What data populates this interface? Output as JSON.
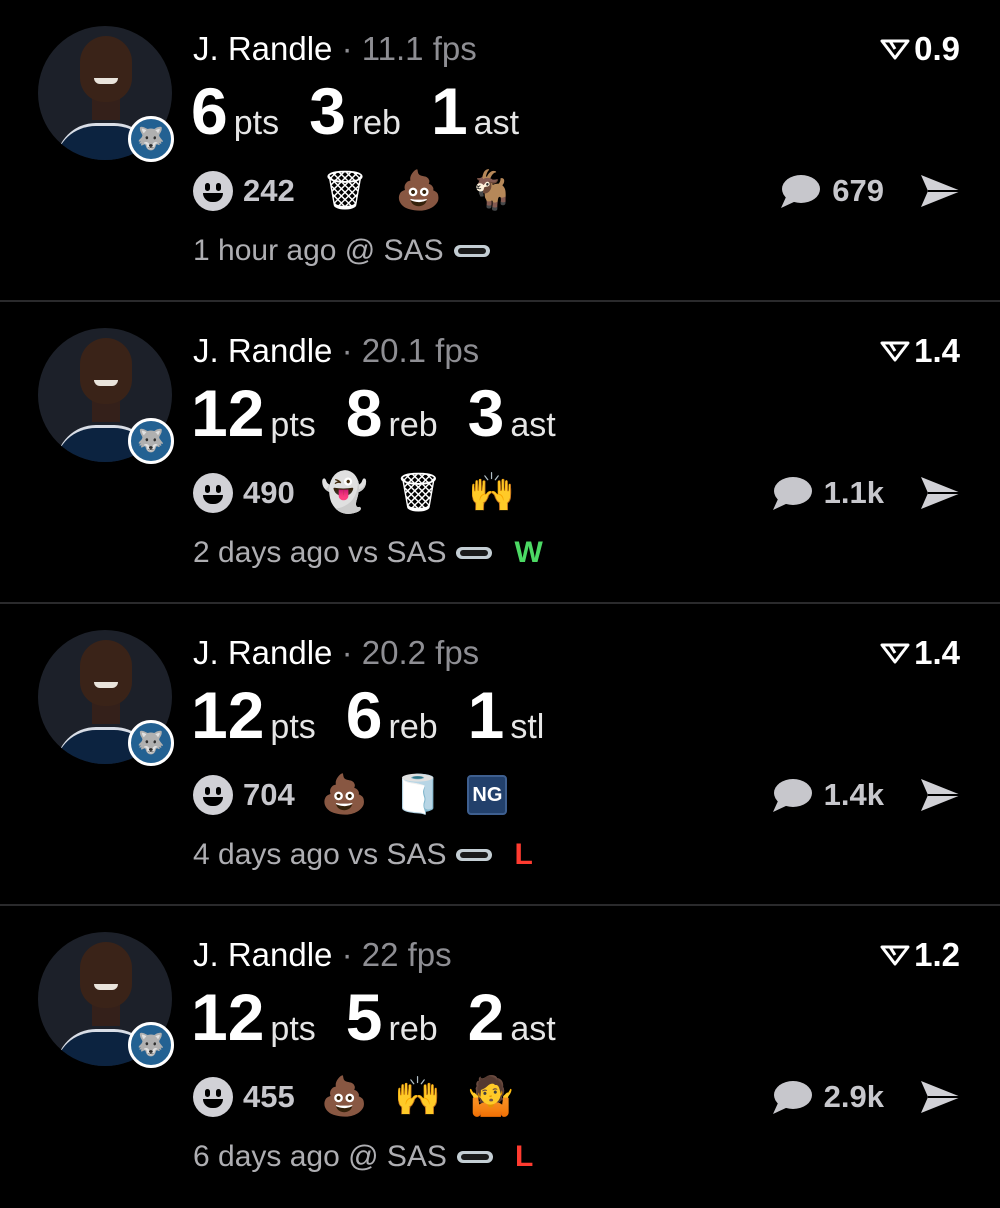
{
  "colors": {
    "win": "#4cd964",
    "loss": "#ff3b30",
    "muted": "#8e8e93",
    "team_badge": "#236192"
  },
  "cards": [
    {
      "name": "J. Randle",
      "fps": "· 11.1 fps",
      "rating": "0.9",
      "stats": [
        {
          "value": "6",
          "label": "pts"
        },
        {
          "value": "3",
          "label": "reb"
        },
        {
          "value": "1",
          "label": "ast"
        }
      ],
      "react_count": "242",
      "reactions": [
        {
          "name": "basketball-hoop-icon",
          "glyph": "🗑"
        },
        {
          "name": "poop-emoji",
          "glyph": "💩"
        },
        {
          "name": "goat-emoji",
          "glyph": "🐐"
        }
      ],
      "comments": "679",
      "meta": "1 hour ago @ SAS",
      "result": "",
      "result_type": ""
    },
    {
      "name": "J. Randle",
      "fps": "· 20.1 fps",
      "rating": "1.4",
      "stats": [
        {
          "value": "12",
          "label": "pts"
        },
        {
          "value": "8",
          "label": "reb"
        },
        {
          "value": "3",
          "label": "ast"
        }
      ],
      "react_count": "490",
      "reactions": [
        {
          "name": "ghost-emoji",
          "glyph": "👻"
        },
        {
          "name": "basketball-hoop-icon",
          "glyph": "🗑"
        },
        {
          "name": "player-sticker",
          "glyph": "🙌"
        }
      ],
      "comments": "1.1k",
      "meta": "2 days ago vs SAS",
      "result": "W",
      "result_type": "win"
    },
    {
      "name": "J. Randle",
      "fps": "· 20.2 fps",
      "rating": "1.4",
      "stats": [
        {
          "value": "12",
          "label": "pts"
        },
        {
          "value": "6",
          "label": "reb"
        },
        {
          "value": "1",
          "label": "stl"
        }
      ],
      "react_count": "704",
      "reactions": [
        {
          "name": "poop-emoji",
          "glyph": "💩"
        },
        {
          "name": "toilet-paper-emoji",
          "glyph": "🧻"
        },
        {
          "name": "ng-badge",
          "glyph": "NG"
        }
      ],
      "comments": "1.4k",
      "meta": "4 days ago vs SAS",
      "result": "L",
      "result_type": "loss"
    },
    {
      "name": "J. Randle",
      "fps": "· 22 fps",
      "rating": "1.2",
      "stats": [
        {
          "value": "12",
          "label": "pts"
        },
        {
          "value": "5",
          "label": "reb"
        },
        {
          "value": "2",
          "label": "ast"
        }
      ],
      "react_count": "455",
      "reactions": [
        {
          "name": "poop-emoji",
          "glyph": "💩"
        },
        {
          "name": "player-sticker",
          "glyph": "🙌"
        },
        {
          "name": "player-sticker",
          "glyph": "🤷"
        }
      ],
      "comments": "2.9k",
      "meta": "6 days ago @ SAS",
      "result": "L",
      "result_type": "loss"
    }
  ]
}
